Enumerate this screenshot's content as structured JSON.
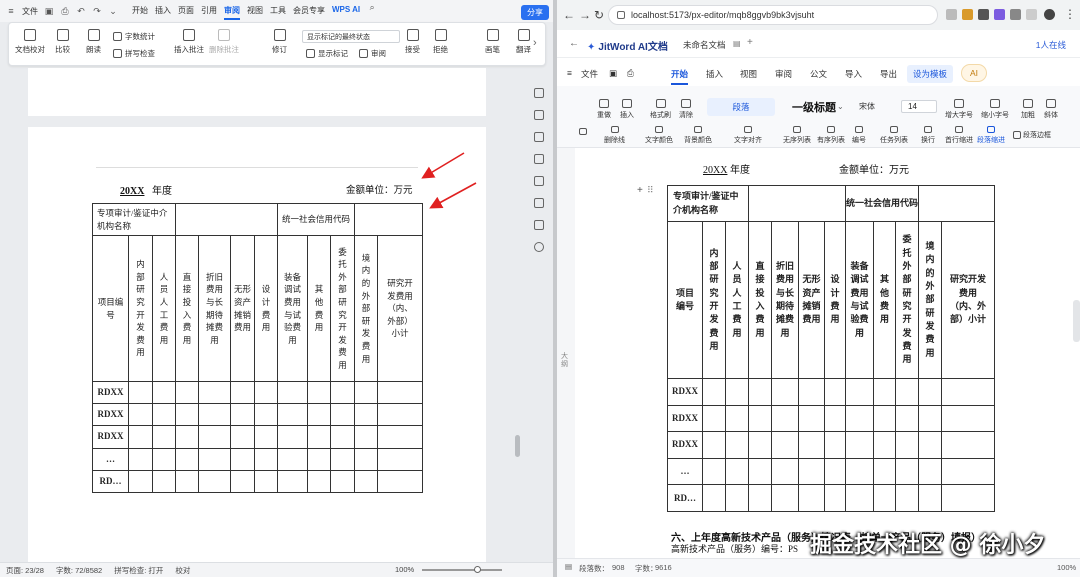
{
  "wps": {
    "file_label": "文件",
    "menus": [
      "开始",
      "插入",
      "页面",
      "引用",
      "审阅",
      "视图",
      "工具",
      "会员专享"
    ],
    "active_menu": "审阅",
    "ai_label": "WPS AI",
    "share_label": "分享",
    "ribbon": {
      "proofread": "文档校对",
      "compare": "比较",
      "read_aloud": "朗读",
      "word_count": "字数统计",
      "spell_check": "拼写检查",
      "insert_comment": "插入批注",
      "delete_comment": "删除批注",
      "revise": "修订",
      "markup_state": "显示标记的最终状态",
      "show_markup": "显示标记",
      "review": "审阅",
      "accept": "接受",
      "reject": "拒绝",
      "pen": "画笔",
      "translate": "翻译"
    },
    "status": {
      "page": "页面: 23/28",
      "words": "字数: 72/8582",
      "spell": "拼写检查: 打开",
      "proof": "校对",
      "zoom": "100%"
    }
  },
  "doc": {
    "year_label": "20XX",
    "year_suffix": "年度",
    "unit": "金额单位：万元",
    "unit_right": "金额单位：万元",
    "h_agency": "专项审计/鉴证中介机构名称",
    "h_credit": "统一社会信用代码",
    "h_item": "项目编号",
    "cols": [
      "内部研究开发费用",
      "人员人工费用",
      "直接投入费用",
      "折旧费用与长期待摊费用",
      "无形资产摊销费用",
      "设计费用",
      "装备调试费用与试验费用",
      "其他费用",
      "委托外部研究开发费用",
      "境内的外部研发费用",
      "研究开发费用（内、外部）小计"
    ],
    "rows": [
      "RDXX",
      "RDXX",
      "RDXX",
      "…",
      "RD…"
    ],
    "section_six": "六、上年度高新技术产品（服务）情况表（按单一产品（服务）填报）",
    "product_no": "高新技术产品（服务）编号：PS"
  },
  "browser": {
    "url": "localhost:5173/px-editor/mqb8ggvb9bk3vjsuht"
  },
  "jitword": {
    "logo": "JitWord AI文档",
    "doc_name": "未命名文档",
    "online": "1人在线",
    "file_label": "文件",
    "menus": [
      "开始",
      "插入",
      "视图",
      "审阅",
      "公文",
      "导入",
      "导出"
    ],
    "active_menu": "开始",
    "template_label": "设为模板",
    "ai_label": "AI",
    "tools": {
      "redo": "重做",
      "insert": "插入",
      "format_painter": "格式刷",
      "clear": "清除",
      "paragraph": "段落",
      "heading": "一级标题",
      "font": "宋体",
      "size": "14",
      "font_bigger": "增大字号",
      "font_smaller": "缩小字号",
      "bold": "加粗",
      "italic": "斜体",
      "strike": "删除线",
      "text_color": "文字颜色",
      "bg_color": "背景颜色",
      "align": "文字对齐",
      "bullet": "无序列表",
      "ordered": "有序列表",
      "numbering": "编号",
      "task_list": "任务列表",
      "line_break": "换行",
      "first_indent": "首行缩进",
      "para_indent": "段落缩进",
      "para_border": "段落边框"
    },
    "status": {
      "paragraphs": "段落数：",
      "paragraphs_val": "908",
      "chars": "字数：",
      "chars_val": "9616",
      "zoom": "100%"
    },
    "gutter_label": "大纲"
  },
  "watermark": "掘金技术社区 @ 徐小夕",
  "colors": {
    "wps_blue": "#1a66e8",
    "jit_blue": "#1a56db",
    "arrow_red": "#e02020"
  }
}
